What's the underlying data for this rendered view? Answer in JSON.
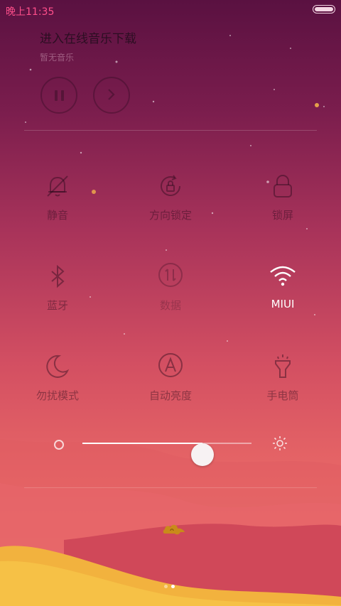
{
  "status": {
    "time": "晚上11:35",
    "battery_level": 1.0
  },
  "music": {
    "title": "进入在线音乐下载",
    "subtitle": "暂无音乐",
    "pause_icon": "pause-icon",
    "next_icon": "chevron-right-icon"
  },
  "toggles": [
    {
      "label": "静音",
      "icon": "bell-off-icon",
      "active": false
    },
    {
      "label": "方向锁定",
      "icon": "rotation-lock-icon",
      "active": false
    },
    {
      "label": "锁屏",
      "icon": "lock-icon",
      "active": false
    },
    {
      "label": "蓝牙",
      "icon": "bluetooth-icon",
      "active": false
    },
    {
      "label": "数据",
      "icon": "mobile-data-icon",
      "active": false
    },
    {
      "label": "MIUI",
      "icon": "wifi-icon",
      "active": true
    },
    {
      "label": "勿扰模式",
      "icon": "moon-icon",
      "active": false
    },
    {
      "label": "自动亮度",
      "icon": "auto-brightness-icon",
      "active": false
    },
    {
      "label": "手电筒",
      "icon": "flashlight-icon",
      "active": false
    }
  ],
  "brightness": {
    "level": 0.71,
    "min_icon": "brightness-low-icon",
    "max_icon": "brightness-high-icon"
  },
  "pager": {
    "count": 2,
    "active_index": 1
  },
  "colors": {
    "accent_time": "#ff4f8b",
    "active_label": "#ffffff",
    "cloud": "#c98a1a"
  }
}
